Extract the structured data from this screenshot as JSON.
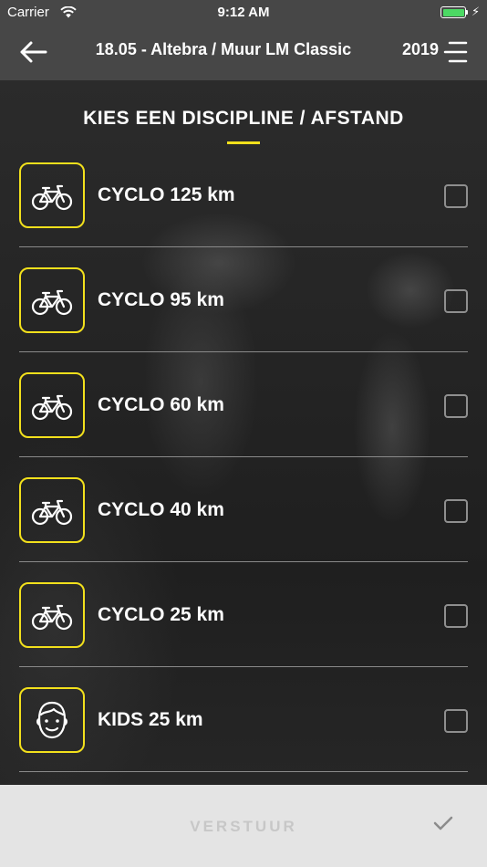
{
  "status_bar": {
    "carrier": "Carrier",
    "time": "9:12 AM"
  },
  "navbar": {
    "title": "18.05 - Altebra / Muur LM Classic",
    "year": "2019"
  },
  "heading": "KIES EEN DISCIPLINE / AFSTAND",
  "items": [
    {
      "label": "CYCLO 125 km",
      "icon": "bicycle-icon"
    },
    {
      "label": "CYCLO 95 km",
      "icon": "bicycle-icon"
    },
    {
      "label": "CYCLO 60 km",
      "icon": "bicycle-icon"
    },
    {
      "label": "CYCLO 40 km",
      "icon": "bicycle-icon"
    },
    {
      "label": "CYCLO 25 km",
      "icon": "bicycle-icon"
    },
    {
      "label": "KIDS 25 km",
      "icon": "kid-face-icon"
    }
  ],
  "footer": {
    "submit_label": "VERSTUUR"
  },
  "colors": {
    "accent": "#f2e01c",
    "bar": "#474747",
    "footer": "#e4e4e4"
  }
}
